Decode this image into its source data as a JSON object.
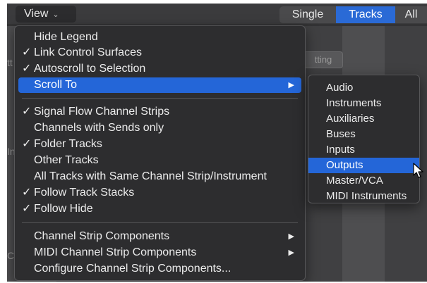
{
  "toolbar": {
    "view_label": "View",
    "segments": [
      "Single",
      "Tracks",
      "All"
    ],
    "selected_segment": "Tracks"
  },
  "background": {
    "pill_label": "tting",
    "partial_text_1": "tt",
    "partial_text_2": "In",
    "partial_text_3": "C"
  },
  "menu": {
    "items": [
      {
        "label": "Hide Legend",
        "checked": false
      },
      {
        "label": "Link Control Surfaces",
        "checked": true
      },
      {
        "label": "Autoscroll to Selection",
        "checked": true
      },
      {
        "label": "Scroll To",
        "checked": false,
        "submenu": true,
        "highlighted": true
      },
      {
        "label": "Signal Flow Channel Strips",
        "checked": true
      },
      {
        "label": "Channels with Sends only",
        "checked": false
      },
      {
        "label": "Folder Tracks",
        "checked": true
      },
      {
        "label": "Other Tracks",
        "checked": false
      },
      {
        "label": "All Tracks with Same Channel Strip/Instrument",
        "checked": false
      },
      {
        "label": "Follow Track Stacks",
        "checked": true
      },
      {
        "label": "Follow Hide",
        "checked": true
      },
      {
        "label": "Channel Strip Components",
        "checked": false,
        "submenu": true
      },
      {
        "label": "MIDI Channel Strip Components",
        "checked": false,
        "submenu": true
      },
      {
        "label": "Configure Channel Strip Components...",
        "checked": false
      }
    ],
    "check_glyph": "✓",
    "arrow_glyph": "▶"
  },
  "submenu": {
    "items": [
      "Audio",
      "Instruments",
      "Auxiliaries",
      "Buses",
      "Inputs",
      "Outputs",
      "Master/VCA",
      "MIDI Instruments"
    ],
    "highlighted": "Outputs"
  },
  "colors": {
    "highlight": "#2466d8",
    "menu_bg": "#2d2d2f",
    "segment_selected": "#2a6ad6"
  }
}
